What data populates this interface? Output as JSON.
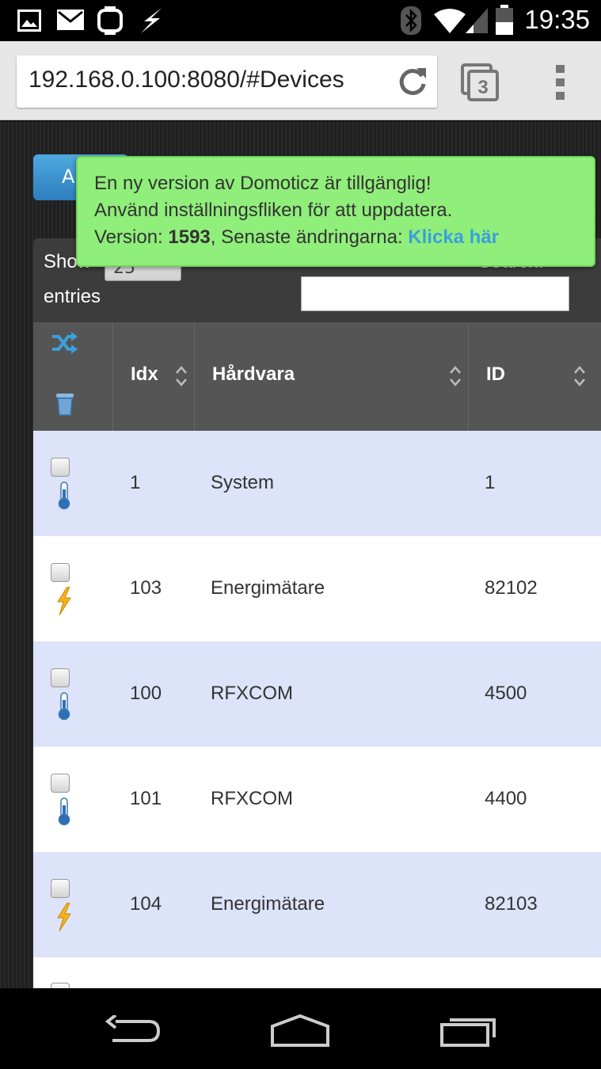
{
  "status_bar": {
    "time": "19:35",
    "icons": [
      "gallery-icon",
      "mail-icon",
      "watch-icon",
      "flash-icon",
      "bluetooth-icon",
      "wifi-icon",
      "signal-icon",
      "battery-icon"
    ]
  },
  "browser": {
    "url": "192.168.0.100:8080/#Devices",
    "tab_count": "3"
  },
  "page": {
    "add_button_label": "A",
    "show_label": "Show",
    "entries_select_value": "25",
    "entries_label": "entries",
    "search_label": "Search:",
    "search_value": ""
  },
  "notification": {
    "line1": "En ny version av Domoticz är tillgänglig!",
    "line2": "Använd inställningsfliken för att uppdatera.",
    "version_prefix": "Version: ",
    "version_number": "1593",
    "changes_text": ", Senaste ändringarna: ",
    "link_text": "Klicka här",
    "color": "#90ee7a"
  },
  "table": {
    "headers": {
      "idx": "Idx",
      "hardware": "Hårdvara",
      "id": "ID"
    },
    "header_icons": [
      "shuffle-icon",
      "trash-icon"
    ],
    "rows": [
      {
        "idx": "1",
        "hardware": "System",
        "id": "1",
        "icon": "thermometer-icon"
      },
      {
        "idx": "103",
        "hardware": "Energimätare",
        "id": "82102",
        "icon": "lightning-icon"
      },
      {
        "idx": "100",
        "hardware": "RFXCOM",
        "id": "4500",
        "icon": "thermometer-icon"
      },
      {
        "idx": "101",
        "hardware": "RFXCOM",
        "id": "4400",
        "icon": "thermometer-icon"
      },
      {
        "idx": "104",
        "hardware": "Energimätare",
        "id": "82103",
        "icon": "lightning-icon"
      }
    ]
  },
  "colors": {
    "row_odd": "#dde3f8",
    "row_even": "#ffffff",
    "header_bg": "#555555",
    "accent_blue": "#3aa0dc"
  }
}
